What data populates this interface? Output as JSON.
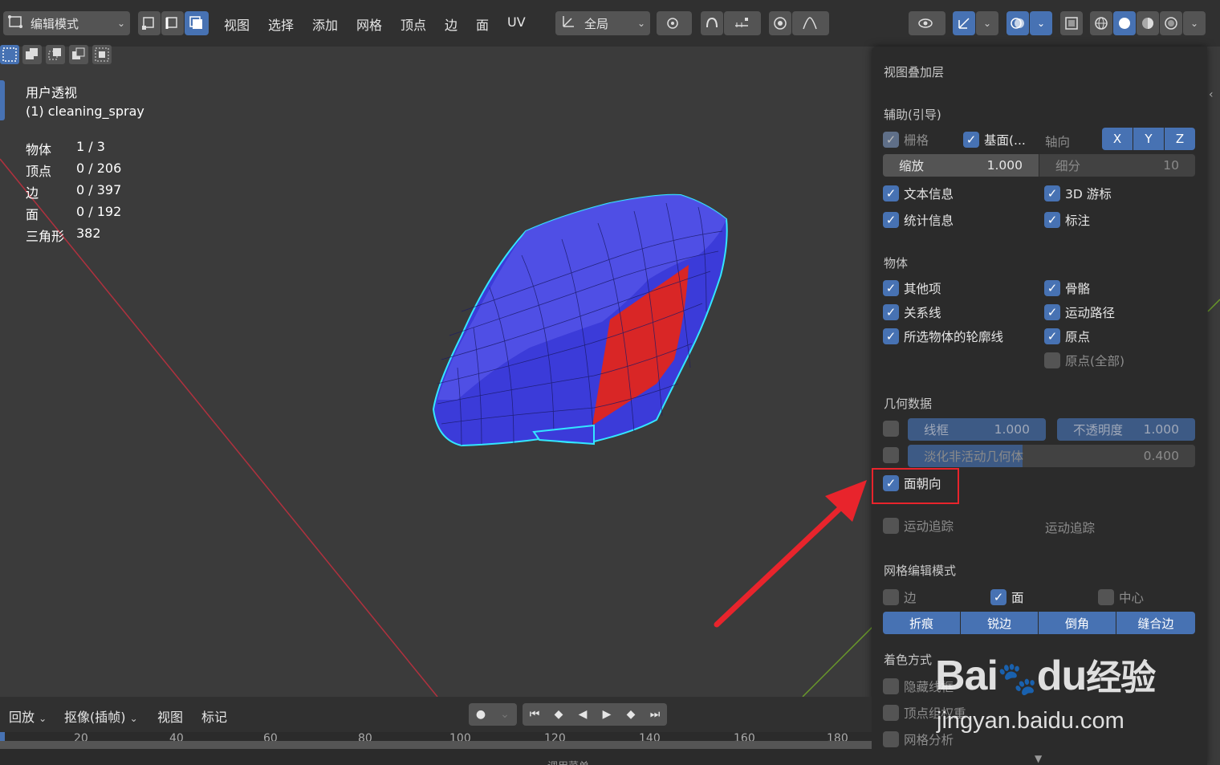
{
  "header": {
    "mode_label": "编辑模式",
    "menus": [
      "视图",
      "选择",
      "添加",
      "网格",
      "顶点",
      "边",
      "面",
      "UV"
    ],
    "transform_orientation": "全局"
  },
  "viewport_info": {
    "view_name": "用户透视",
    "object_name": "(1) cleaning_spray",
    "stats": [
      {
        "label": "物体",
        "value": "1 / 3"
      },
      {
        "label": "顶点",
        "value": "0 / 206"
      },
      {
        "label": "边",
        "value": "0 / 397"
      },
      {
        "label": "面",
        "value": "0 / 192"
      },
      {
        "label": "三角形",
        "value": "382"
      }
    ]
  },
  "overlay_panel": {
    "title": "视图叠加层",
    "guides_title": "辅助(引导)",
    "grid_label": "栅格",
    "floor_label": "基面(...",
    "axis_label": "轴向",
    "axis_x": "X",
    "axis_y": "Y",
    "axis_z": "Z",
    "scale_label": "缩放",
    "scale_value": "1.000",
    "subdiv_label": "细分",
    "subdiv_value": "10",
    "text_info": "文本信息",
    "cursor_3d": "3D 游标",
    "statistics": "统计信息",
    "annotations": "标注",
    "objects_title": "物体",
    "extras": "其他项",
    "bones": "骨骼",
    "relationship_lines": "关系线",
    "motion_paths": "运动路径",
    "outline_selected": "所选物体的轮廓线",
    "origins": "原点",
    "origins_all": "原点(全部)",
    "geometry_title": "几何数据",
    "wireframe_label": "线框",
    "wireframe_value": "1.000",
    "opacity_label": "不透明度",
    "opacity_value": "1.000",
    "fade_inactive_label": "淡化非活动几何体",
    "fade_inactive_value": "0.400",
    "face_orientation": "面朝向",
    "motion_tracking": "运动追踪",
    "motion_tracking_right": "运动追踪",
    "mesh_edit_title": "网格编辑模式",
    "edges": "边",
    "faces": "面",
    "center": "中心",
    "crease": "折痕",
    "sharp": "锐边",
    "bevel": "倒角",
    "seams": "缝合边",
    "shading_title": "着色方式",
    "hidden_wire": "隐藏线框",
    "vertex_group_weights": "顶点组权重",
    "mesh_analysis": "网格分析"
  },
  "timeline": {
    "playback": "回放",
    "keying": "抠像(插帧)",
    "view": "视图",
    "marker": "标记",
    "ticks": [
      "20",
      "40",
      "60",
      "80",
      "100",
      "120",
      "140",
      "160",
      "180"
    ],
    "bottom_label": "调用菜单"
  },
  "watermark": {
    "brand": "Bai",
    "brand_du": "du",
    "brand_cn": "经验",
    "url": "jingyan.baidu.com"
  },
  "colors": {
    "accent": "#4772b3",
    "face_front": "#3b3bd9",
    "face_back": "#d92626",
    "selection_outline": "#33e6ff",
    "highlight_box": "#e8242c"
  }
}
